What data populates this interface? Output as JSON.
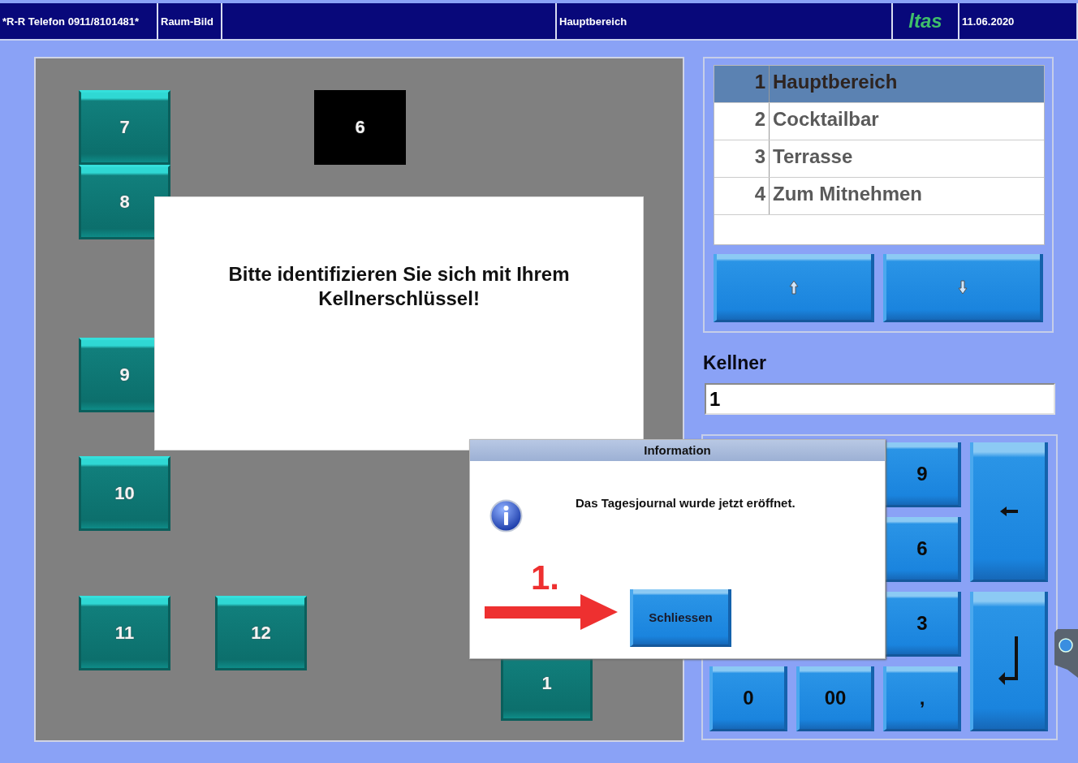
{
  "header": {
    "cells": [
      {
        "text": "*R-R Telefon 0911/8101481*",
        "kind": "text"
      },
      {
        "text": "Raum-Bild",
        "kind": "text"
      },
      {
        "text": "",
        "kind": "spacer"
      },
      {
        "text": "Hauptbereich",
        "kind": "text"
      },
      {
        "text": "ltas",
        "kind": "logo"
      },
      {
        "text": "11.06.2020",
        "kind": "text"
      }
    ]
  },
  "floor": {
    "tables": [
      {
        "label": "7",
        "occupied": false
      },
      {
        "label": "6",
        "occupied": true
      },
      {
        "label": "8",
        "occupied": false
      },
      {
        "label": "9",
        "occupied": false
      },
      {
        "label": "10",
        "occupied": false
      },
      {
        "label": "11",
        "occupied": false
      },
      {
        "label": "12",
        "occupied": false
      },
      {
        "label": "1",
        "occupied": false
      }
    ],
    "message": "Bitte identifizieren Sie sich mit Ihrem Kellnerschlüssel!"
  },
  "areas": [
    {
      "number": "1",
      "name": "Hauptbereich",
      "selected": true
    },
    {
      "number": "2",
      "name": "Cocktailbar",
      "selected": false
    },
    {
      "number": "3",
      "name": "Terrasse",
      "selected": false
    },
    {
      "number": "4",
      "name": "Zum Mitnehmen",
      "selected": false
    }
  ],
  "waiter": {
    "label": "Kellner",
    "value": "1"
  },
  "keypad": [
    {
      "kind": "digit",
      "label": "9"
    },
    {
      "kind": "backspace"
    },
    {
      "kind": "digit",
      "label": "6"
    },
    {
      "kind": "digit",
      "label": "3"
    },
    {
      "kind": "enter"
    },
    {
      "kind": "digit",
      "label": "0"
    },
    {
      "kind": "digit",
      "label": "00"
    },
    {
      "kind": "digit",
      "label": ","
    }
  ],
  "dialog": {
    "title": "Information",
    "message": "Das Tagesjournal wurde jetzt eröffnet.",
    "button": "Schliessen"
  },
  "annotation": {
    "step": "1."
  }
}
